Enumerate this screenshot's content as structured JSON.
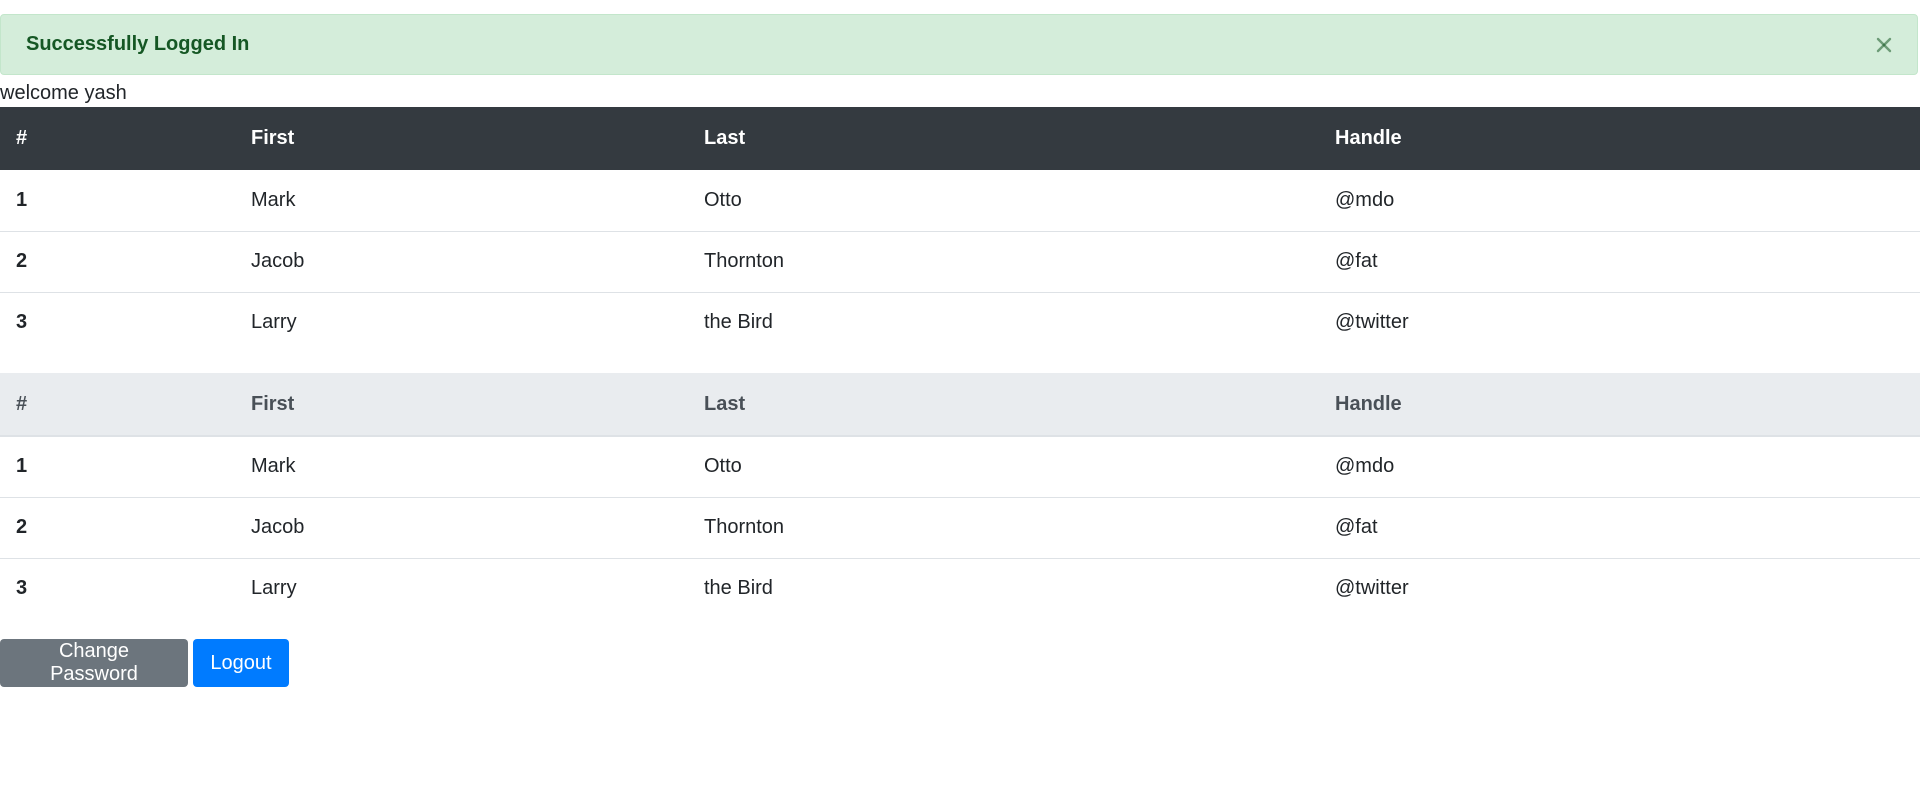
{
  "alert": {
    "message": "Successfully Logged In",
    "close_icon": "close-icon",
    "color": "#155724",
    "background": "#d4edda"
  },
  "welcome": "welcome yash",
  "table_dark": {
    "headers": [
      "#",
      "First",
      "Last",
      "Handle"
    ],
    "rows": [
      [
        "1",
        "Mark",
        "Otto",
        "@mdo"
      ],
      [
        "2",
        "Jacob",
        "Thornton",
        "@fat"
      ],
      [
        "3",
        "Larry",
        "the Bird",
        "@twitter"
      ]
    ]
  },
  "table_light": {
    "headers": [
      "#",
      "First",
      "Last",
      "Handle"
    ],
    "rows": [
      [
        "1",
        "Mark",
        "Otto",
        "@mdo"
      ],
      [
        "2",
        "Jacob",
        "Thornton",
        "@fat"
      ],
      [
        "3",
        "Larry",
        "the Bird",
        "@twitter"
      ]
    ]
  },
  "buttons": {
    "change_password": "Change Password",
    "logout": "Logout"
  },
  "colors": {
    "dark_header": "#343a40",
    "light_header": "#e9ecef",
    "secondary_button": "#6c757d",
    "primary_button": "#007bff"
  }
}
